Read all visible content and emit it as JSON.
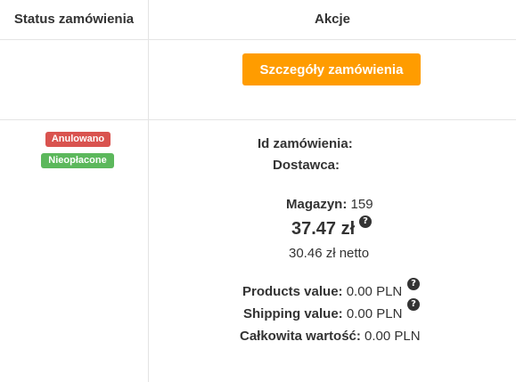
{
  "table": {
    "headers": {
      "status": "Status zamówienia",
      "actions": "Akcje"
    },
    "row1": {
      "details_button": "Szczegóły zamówienia"
    },
    "row2": {
      "badges": {
        "cancelled": "Anulowano",
        "unpaid": "Nieopłacone"
      },
      "order_id_label": "Id zamówienia:",
      "supplier_label": "Dostawca:",
      "warehouse_label": "Magazyn:",
      "warehouse_value": "159",
      "price_gross": "37.47 zł",
      "price_net": "30.46 zł netto",
      "products_value_label": "Products value:",
      "products_value": "0.00 PLN",
      "shipping_value_label": "Shipping value:",
      "shipping_value": "0.00 PLN",
      "total_value_label": "Całkowita wartość:",
      "total_value": "0.00 PLN"
    }
  },
  "colors": {
    "accent_button": "#ff9c00",
    "badge_cancelled": "#d9534f",
    "badge_unpaid": "#5cb85c",
    "border": "#e4e4e4"
  },
  "icons": {
    "help": "question-circle-icon"
  }
}
